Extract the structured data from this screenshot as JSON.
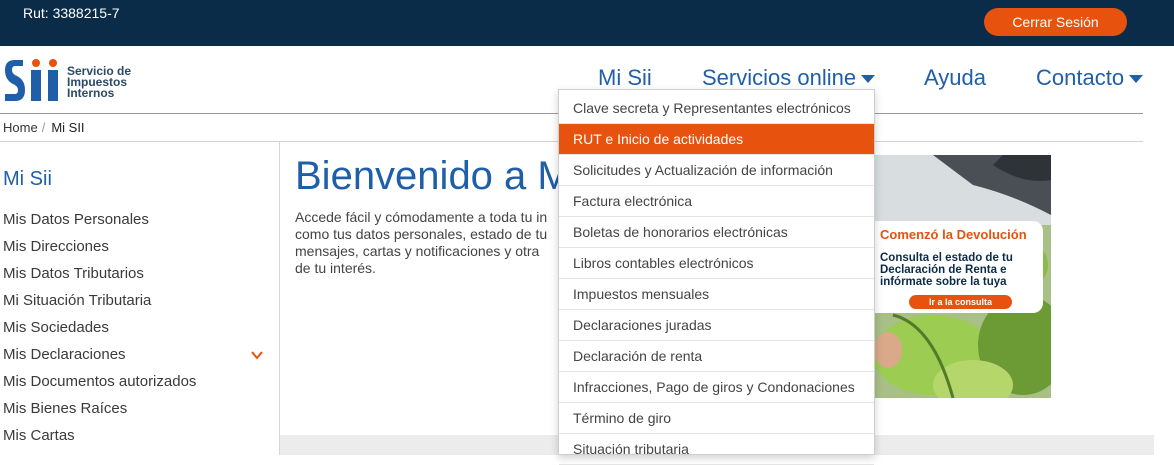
{
  "header": {
    "rut_label": "Rut: 3388215-7",
    "logout_label": "Cerrar Sesión"
  },
  "logo": {
    "line1": "Servicio de",
    "line2": "Impuestos",
    "line3": "Internos"
  },
  "nav": {
    "items": [
      "Mi Sii",
      "Servicios online",
      "Ayuda",
      "Contacto"
    ]
  },
  "breadcrumb": {
    "home": "Home",
    "separator": "/",
    "current": "Mi SII"
  },
  "sidebar": {
    "title": "Mi Sii",
    "items": [
      "Mis Datos Personales",
      "Mis Direcciones",
      "Mis Datos Tributarios",
      "Mi Situación Tributaria",
      "Mis Sociedades",
      "Mis Declaraciones",
      "Mis Documentos autorizados",
      "Mis Bienes Raíces",
      "Mis Cartas"
    ]
  },
  "main": {
    "welcome_title": "Bienvenido a M",
    "intro_text": "Accede fácil y cómodamente a toda tu in\ncomo tus datos personales, estado de tu\nmensajes, cartas y notificaciones y otra\nde tu interés."
  },
  "banner": {
    "title": "Comenzó la Devolución",
    "text": "Consulta el estado de tu Declaración de Renta e infórmate sobre la tuya",
    "button": "Ir a la consulta"
  },
  "dropdown": {
    "items": [
      "Clave secreta y Representantes electrónicos",
      "RUT e Inicio de actividades",
      "Solicitudes y Actualización de información",
      "Factura electrónica",
      "Boletas de honorarios electrónicas",
      "Libros contables electrónicos",
      "Impuestos mensuales",
      "Declaraciones juradas",
      "Declaración de renta",
      "Infracciones, Pago de giros y Condonaciones",
      "Término de giro",
      "Situación tributaria"
    ],
    "active_item": "RUT e Inicio de actividades"
  },
  "colors": {
    "topbar": "#0b2c48",
    "accent_orange": "#e8520f",
    "link_blue": "#1f5fa8"
  }
}
